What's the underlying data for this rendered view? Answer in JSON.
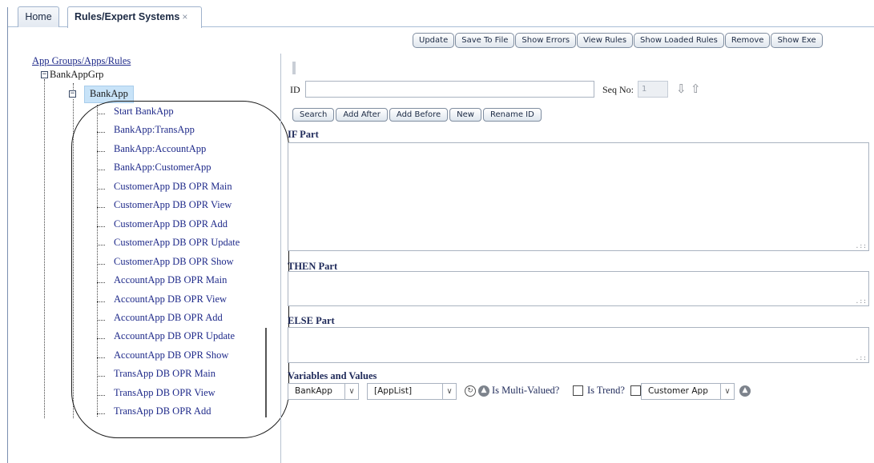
{
  "tabs": {
    "home": "Home",
    "rules": "Rules/Expert Systems",
    "close_glyph": "×"
  },
  "toolbar": {
    "buttons": [
      "Update",
      "Save To File",
      "Show Errors",
      "View Rules",
      "Show Loaded Rules",
      "Remove",
      "Show Exe"
    ]
  },
  "tree": {
    "root_label": "App Groups/Apps/Rules",
    "group": "BankAppGrp",
    "app": "BankApp",
    "expander_glyph": "−",
    "rules": [
      "Start BankApp",
      "BankApp:TransApp",
      "BankApp:AccountApp",
      "BankApp:CustomerApp",
      "CustomerApp DB OPR Main",
      "CustomerApp DB OPR View",
      "CustomerApp DB OPR Add",
      "CustomerApp DB OPR Update",
      "CustomerApp DB OPR Show",
      "AccountApp DB OPR Main",
      "AccountApp DB OPR View",
      "AccountApp DB OPR Add",
      "AccountApp DB OPR Update",
      "AccountApp DB OPR Show",
      "TransApp DB OPR Main",
      "TransApp DB OPR View",
      "TransApp DB OPR Add"
    ]
  },
  "editor": {
    "id_label": "ID",
    "id_value": "",
    "seq_label": "Seq No:",
    "seq_value": "1",
    "down_arrow_icon": "arrow-down-icon",
    "up_arrow_icon": "arrow-up-icon",
    "actions": [
      "Search",
      "Add After",
      "Add Before",
      "New",
      "Rename ID"
    ],
    "if_label": "IF Part",
    "then_label": "THEN Part",
    "else_label": "ELSE Part",
    "vars_label": "Variables and Values"
  },
  "variables": {
    "app_select": "BankApp",
    "list_select": "[AppList]",
    "multi_label": "Is Multi-Valued?",
    "trend_label": "Is Trend?",
    "customer_select": "Customer App",
    "dropdown_glyph": "∨"
  }
}
